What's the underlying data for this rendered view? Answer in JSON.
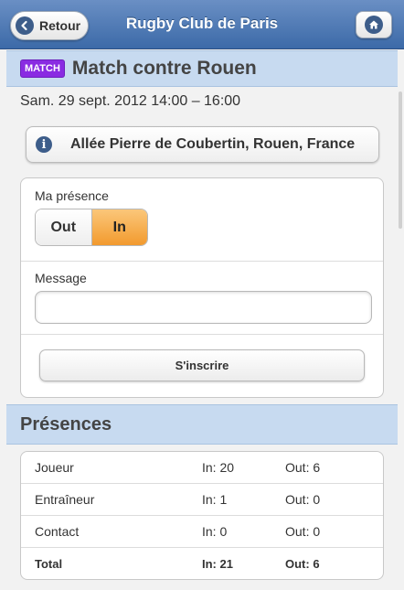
{
  "header": {
    "back_label": "Retour",
    "title": "Rugby Club de Paris",
    "back_icon": "arrow-left-icon",
    "home_icon": "home-icon"
  },
  "event": {
    "badge": "MATCH",
    "title": "Match contre Rouen",
    "date": "Sam. 29 sept. 2012 14:00 – 16:00",
    "address": "Allée Pierre de Coubertin, Rouen, France",
    "badge_color": "#8a2be2"
  },
  "form": {
    "presence_label": "Ma présence",
    "options": [
      "Out",
      "In"
    ],
    "selected": "In",
    "message_label": "Message",
    "message_value": "",
    "submit_label": "S'inscrire"
  },
  "presences": {
    "title": "Présences",
    "rows": [
      {
        "role": "Joueur",
        "in": "In: 20",
        "out": "Out: 6"
      },
      {
        "role": "Entraîneur",
        "in": "In: 1",
        "out": "Out: 0"
      },
      {
        "role": "Contact",
        "in": "In: 0",
        "out": "Out: 0"
      }
    ],
    "total": {
      "role": "Total",
      "in": "In: 21",
      "out": "Out: 6"
    }
  },
  "colors": {
    "header": "#3c6aa8",
    "section_bar": "#c7daf0",
    "selected_segment": "#f29a2e"
  }
}
